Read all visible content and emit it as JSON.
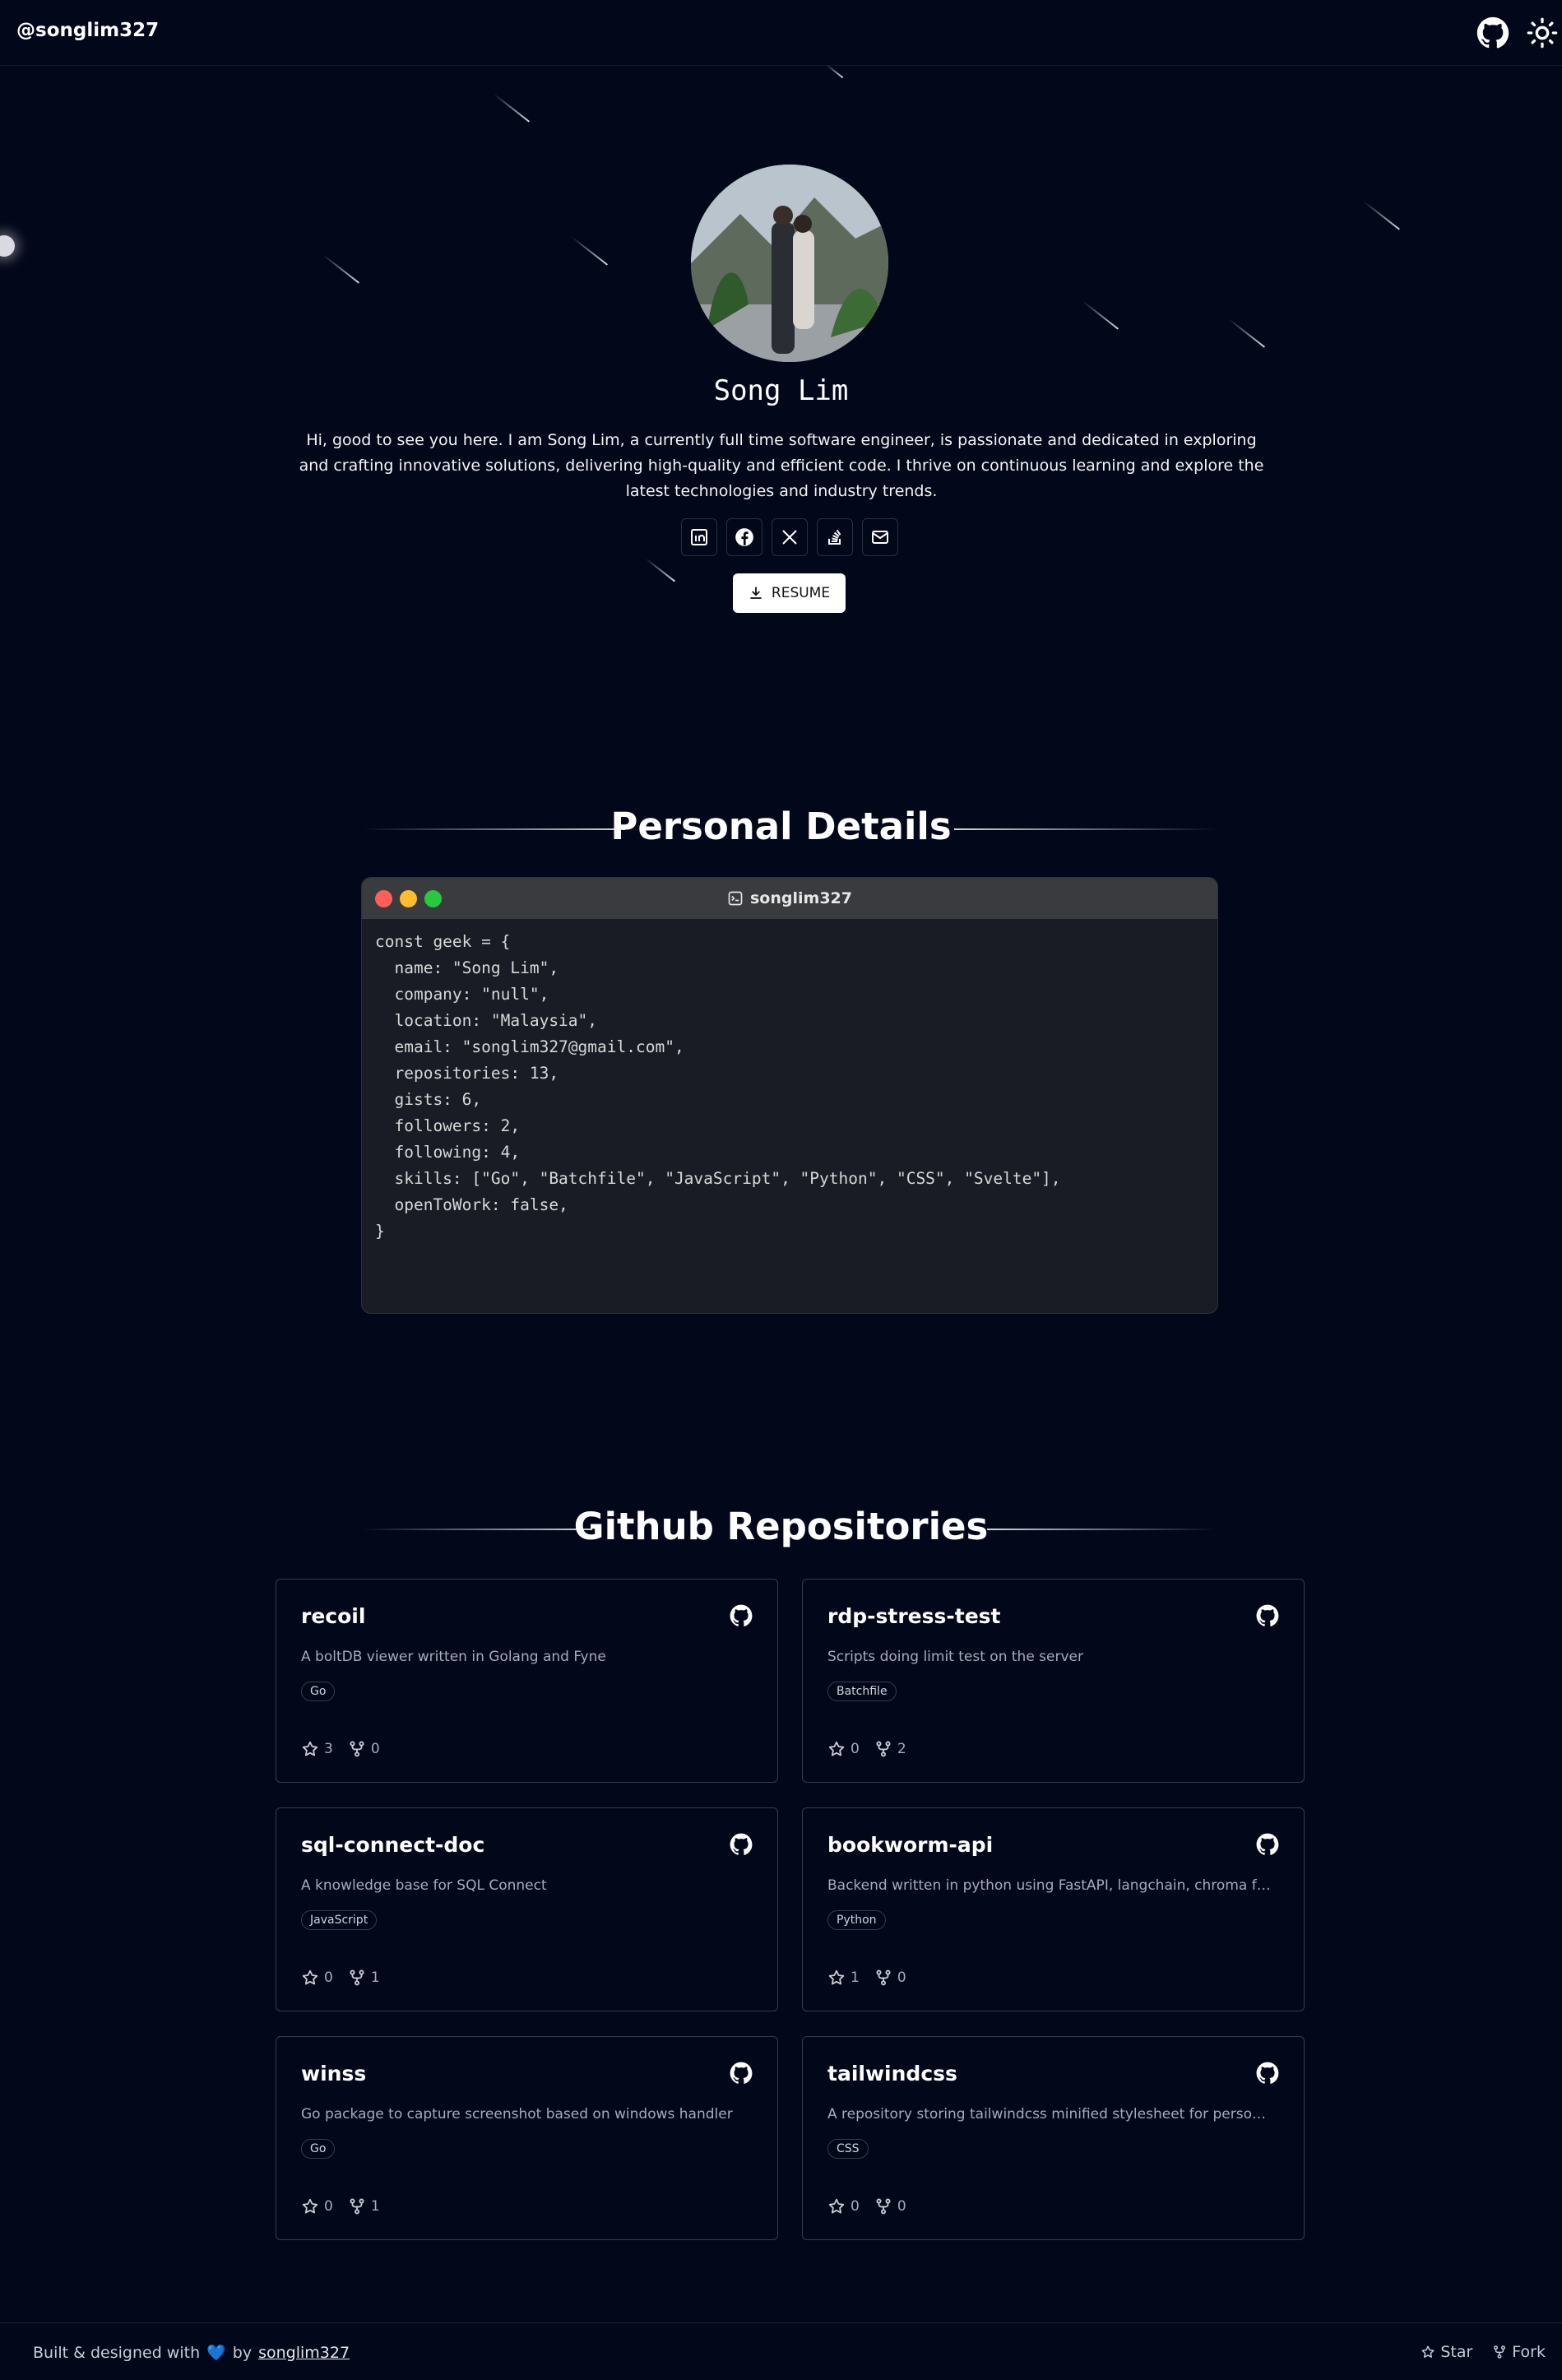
{
  "header": {
    "brand": "@songlim327"
  },
  "profile": {
    "name": "Song Lim",
    "bio": "Hi, good to see you here. I am Song Lim, a currently full time software engineer, is passionate and dedicated in exploring and crafting innovative solutions, delivering high-quality and efficient code. I thrive on continuous learning and explore the latest technologies and industry trends.",
    "resume_label": "RESUME"
  },
  "personal_details": {
    "title": "Personal Details",
    "terminal_title": "songlim327",
    "code_lines": [
      "const geek = {",
      "  name: \"Song Lim\",",
      "  company: \"null\",",
      "  location: \"Malaysia\",",
      "  email: \"songlim327@gmail.com\",",
      "  repositories: 13,",
      "  gists: 6,",
      "  followers: 2,",
      "  following: 4,",
      "  skills: [\"Go\", \"Batchfile\", \"JavaScript\", \"Python\", \"CSS\", \"Svelte\"],",
      "  openToWork: false,",
      "}"
    ]
  },
  "repos_section": {
    "title": "Github Repositories",
    "repos": [
      {
        "name": "recoil",
        "desc": "A boltDB viewer written in Golang and Fyne",
        "lang": "Go",
        "stars": "3",
        "forks": "0"
      },
      {
        "name": "rdp-stress-test",
        "desc": "Scripts doing limit test on the server",
        "lang": "Batchfile",
        "stars": "0",
        "forks": "2"
      },
      {
        "name": "sql-connect-doc",
        "desc": "A knowledge base for SQL Connect",
        "lang": "JavaScript",
        "stars": "0",
        "forks": "1"
      },
      {
        "name": "bookworm-api",
        "desc": "Backend written in python using FastAPI, langchain, chroma for RAG...",
        "lang": "Python",
        "stars": "1",
        "forks": "0"
      },
      {
        "name": "winss",
        "desc": "Go package to capture screenshot based on windows handler",
        "lang": "Go",
        "stars": "0",
        "forks": "1"
      },
      {
        "name": "tailwindcss",
        "desc": "A repository storing tailwindcss minified stylesheet for personal...",
        "lang": "CSS",
        "stars": "0",
        "forks": "0"
      }
    ]
  },
  "footer": {
    "built_text": "Built & designed with",
    "heart": "💙",
    "by": "by",
    "author": "songlim327",
    "star_label": "Star",
    "fork_label": "Fork"
  },
  "icons": {
    "github": "github-icon",
    "theme": "sun-icon",
    "linkedin": "linkedin-icon",
    "facebook": "facebook-icon",
    "x": "x-icon",
    "stackoverflow": "stackoverflow-icon",
    "email": "mail-icon",
    "download": "download-icon",
    "terminal": "terminal-icon",
    "star": "star-icon",
    "fork": "fork-icon"
  },
  "colors": {
    "background": "#03071a",
    "terminal_bg": "#191c25",
    "dot_red": "#fe5f57",
    "dot_yellow": "#febc2e",
    "dot_green": "#28c840"
  }
}
